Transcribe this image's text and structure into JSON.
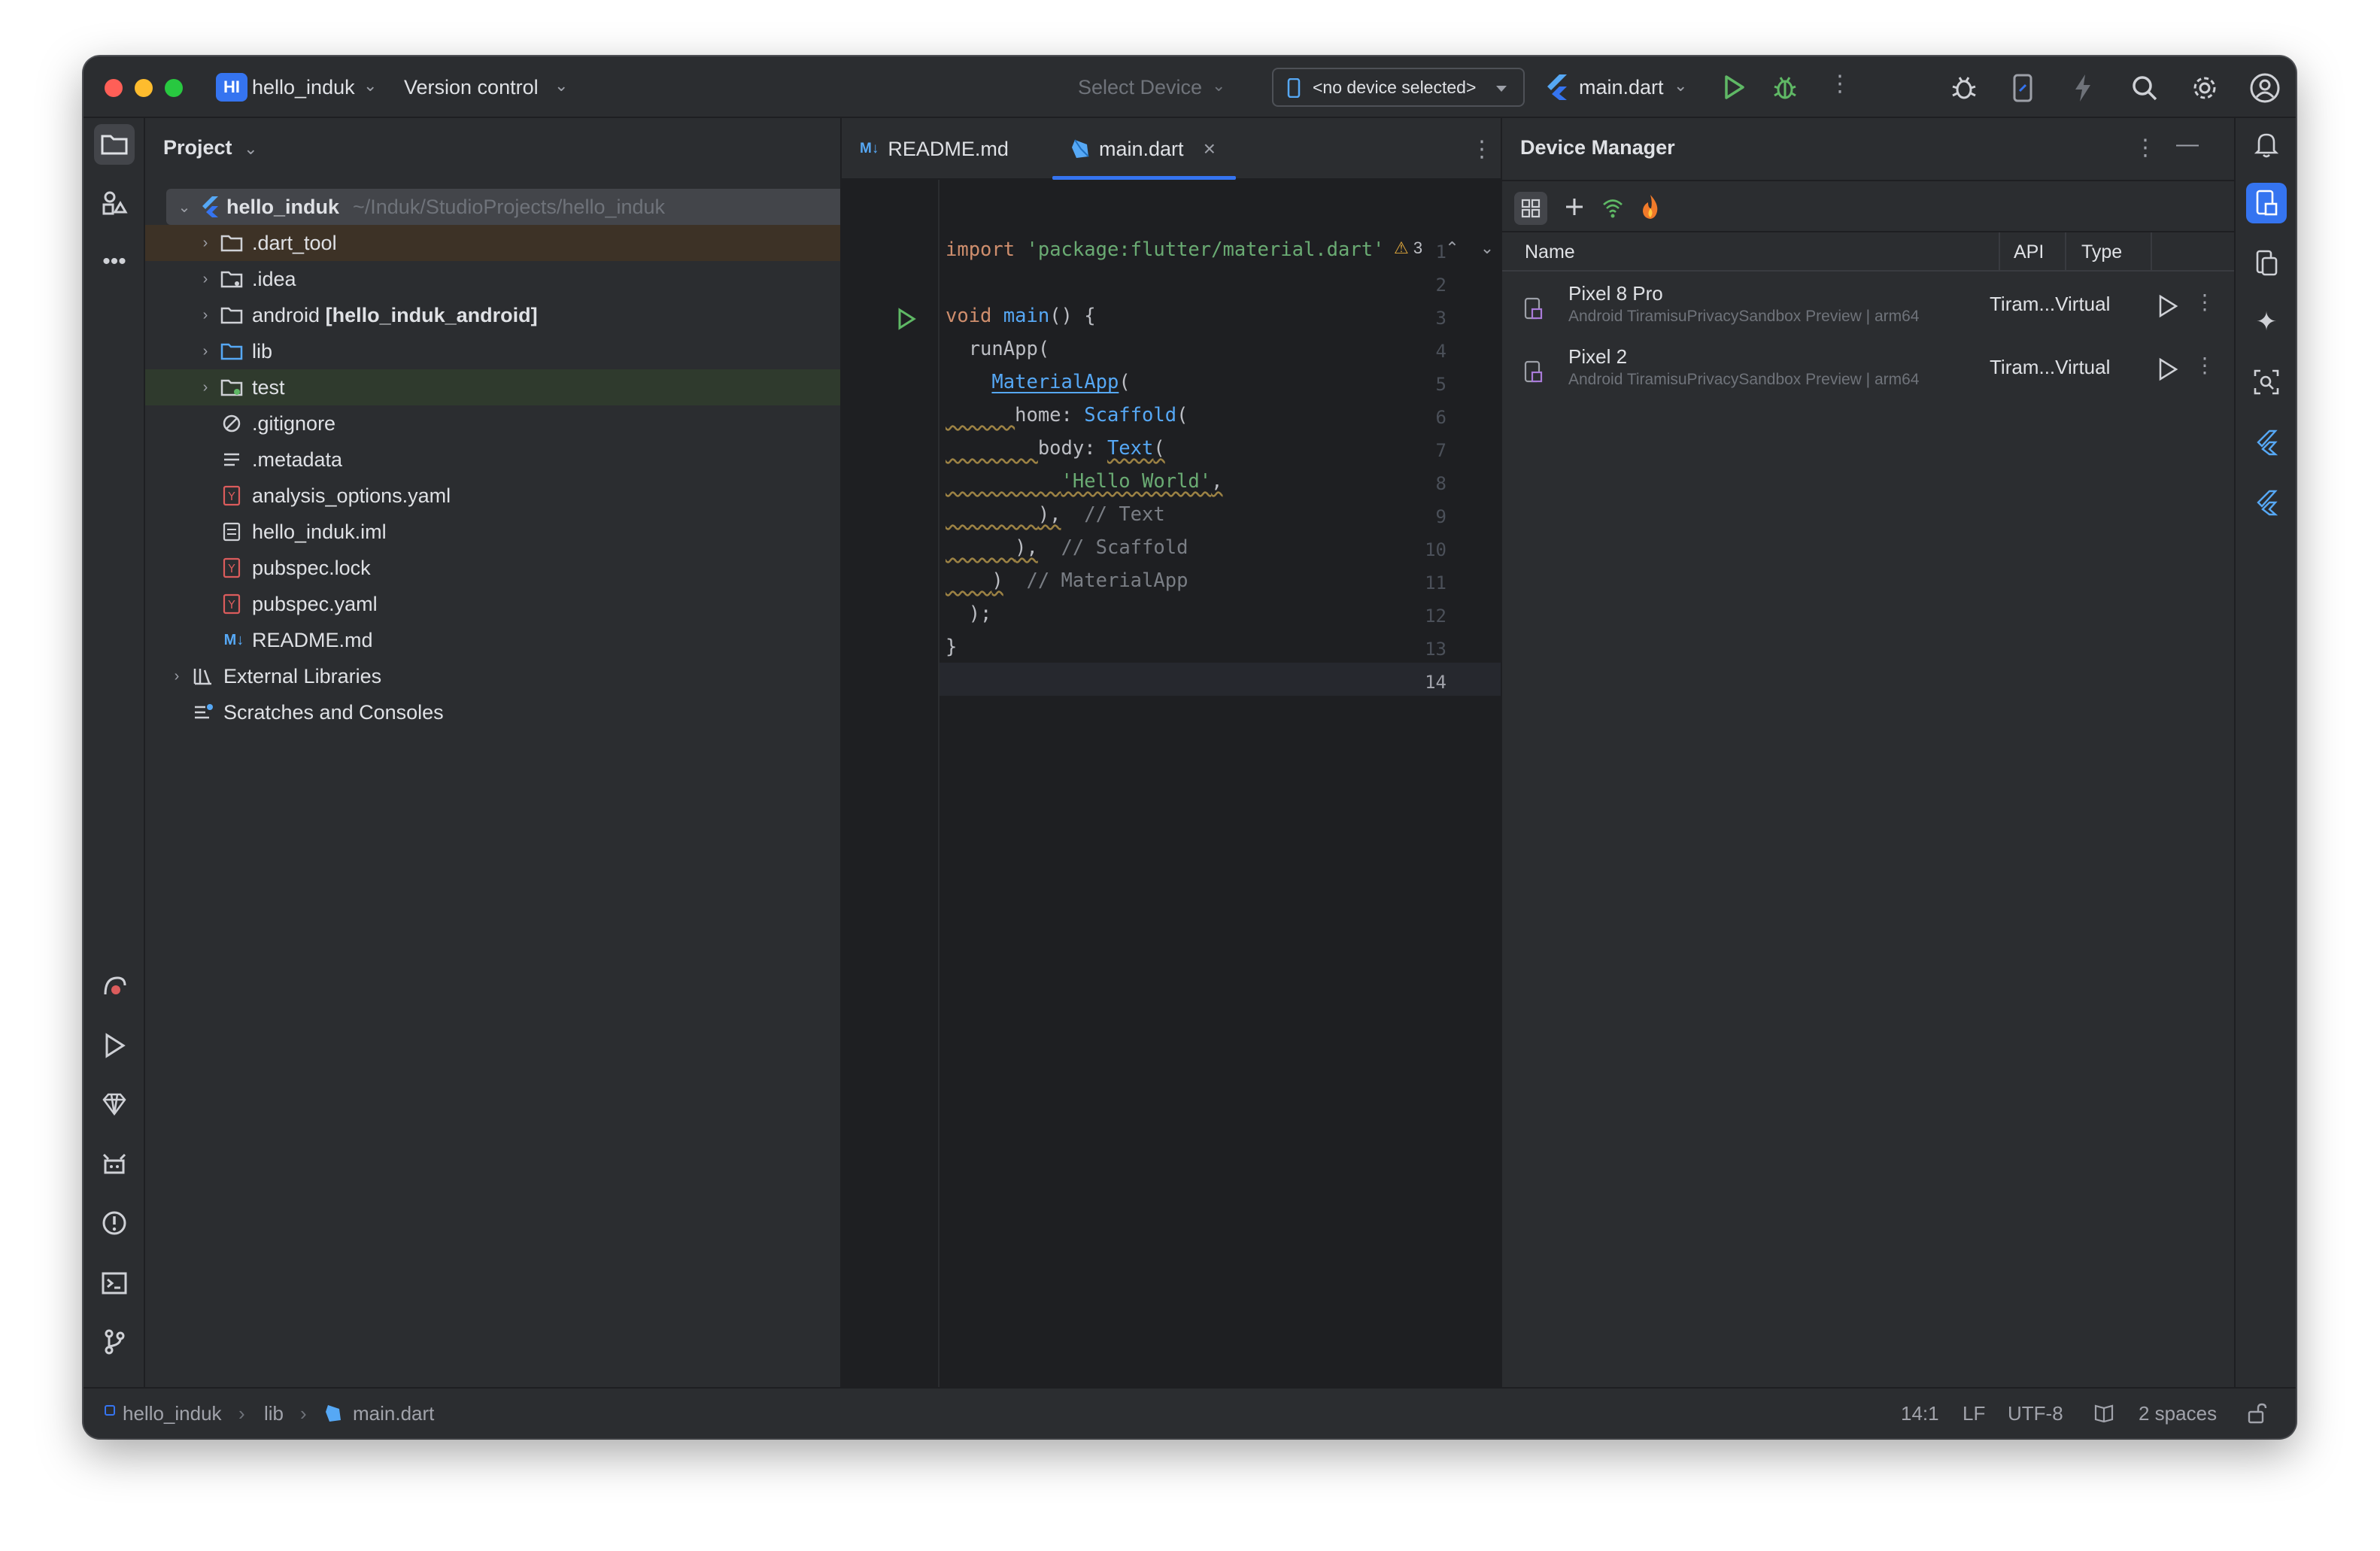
{
  "titlebar": {
    "project_initials": "HI",
    "project_name": "hello_induk",
    "vcs_label": "Version control",
    "select_device": "Select Device",
    "no_device": "<no device selected>",
    "run_config": "main.dart"
  },
  "project_panel": {
    "title": "Project",
    "root_name": "hello_induk",
    "root_path": "~/Induk/StudioProjects/hello_induk",
    "items": [
      {
        "label": ".dart_tool",
        "icon": "folder-icon"
      },
      {
        "label": ".idea",
        "icon": "folder-icon"
      },
      {
        "label": "android",
        "bold_suffix": "[hello_induk_android]",
        "icon": "folder-icon"
      },
      {
        "label": "lib",
        "icon": "folder-icon"
      },
      {
        "label": "test",
        "icon": "folder-icon"
      },
      {
        "label": ".gitignore",
        "icon": "ignore-file-icon"
      },
      {
        "label": ".metadata",
        "icon": "text-file-icon"
      },
      {
        "label": "analysis_options.yaml",
        "icon": "yaml-file-icon"
      },
      {
        "label": "hello_induk.iml",
        "icon": "iml-file-icon"
      },
      {
        "label": "pubspec.lock",
        "icon": "yaml-file-icon"
      },
      {
        "label": "pubspec.yaml",
        "icon": "yaml-file-icon"
      },
      {
        "label": "README.md",
        "icon": "markdown-file-icon"
      }
    ],
    "external_libraries": "External Libraries",
    "scratches": "Scratches and Consoles"
  },
  "editor": {
    "tabs": [
      {
        "label": "README.md",
        "icon": "M↓"
      },
      {
        "label": "main.dart",
        "close": "×"
      }
    ],
    "warning_count": "3",
    "line_numbers": [
      "1",
      "2",
      "3",
      "4",
      "5",
      "6",
      "7",
      "8",
      "9",
      "10",
      "11",
      "12",
      "13",
      "14"
    ],
    "code": {
      "l1_kw": "import",
      "l1_str": "'package:flutter/material.dart'",
      "l3_kw": "void",
      "l3_fn": "main",
      "l3_rest": "() {",
      "l4": "  runApp(",
      "l5_cls": "MaterialApp",
      "l5_rest": "(",
      "l6_key": "home: ",
      "l6_cls": "Scaffold",
      "l6_rest": "(",
      "l7_key": "body: ",
      "l7_cls": "Text",
      "l7_rest": "(",
      "l8_str": "'Hello World'",
      "l8_rest": ",",
      "l9_code": "),",
      "l9_cmt": "// Text",
      "l10_code": "),",
      "l10_cmt": "// Scaffold",
      "l11_code": ")",
      "l11_cmt": "// MaterialApp",
      "l12": "  );",
      "l13": "}"
    }
  },
  "device_manager": {
    "title": "Device Manager",
    "columns": {
      "name": "Name",
      "api": "API",
      "type": "Type"
    },
    "devices": [
      {
        "name": "Pixel 8 Pro",
        "subtitle": "Android TiramisuPrivacySandbox Preview | arm64",
        "api_type": "Tiram...Virtual"
      },
      {
        "name": "Pixel 2",
        "subtitle": "Android TiramisuPrivacySandbox Preview | arm64",
        "api_type": "Tiram...Virtual"
      }
    ]
  },
  "statusbar": {
    "crumb_project": "hello_induk",
    "crumb_dir": "lib",
    "crumb_file": "main.dart",
    "position": "14:1",
    "line_sep": "LF",
    "encoding": "UTF-8",
    "indent": "2 spaces"
  },
  "colors": {
    "accent": "#3574f0",
    "run_green": "#5fb865",
    "window_bg": "#2b2d30",
    "editor_bg": "#1e1f22"
  }
}
